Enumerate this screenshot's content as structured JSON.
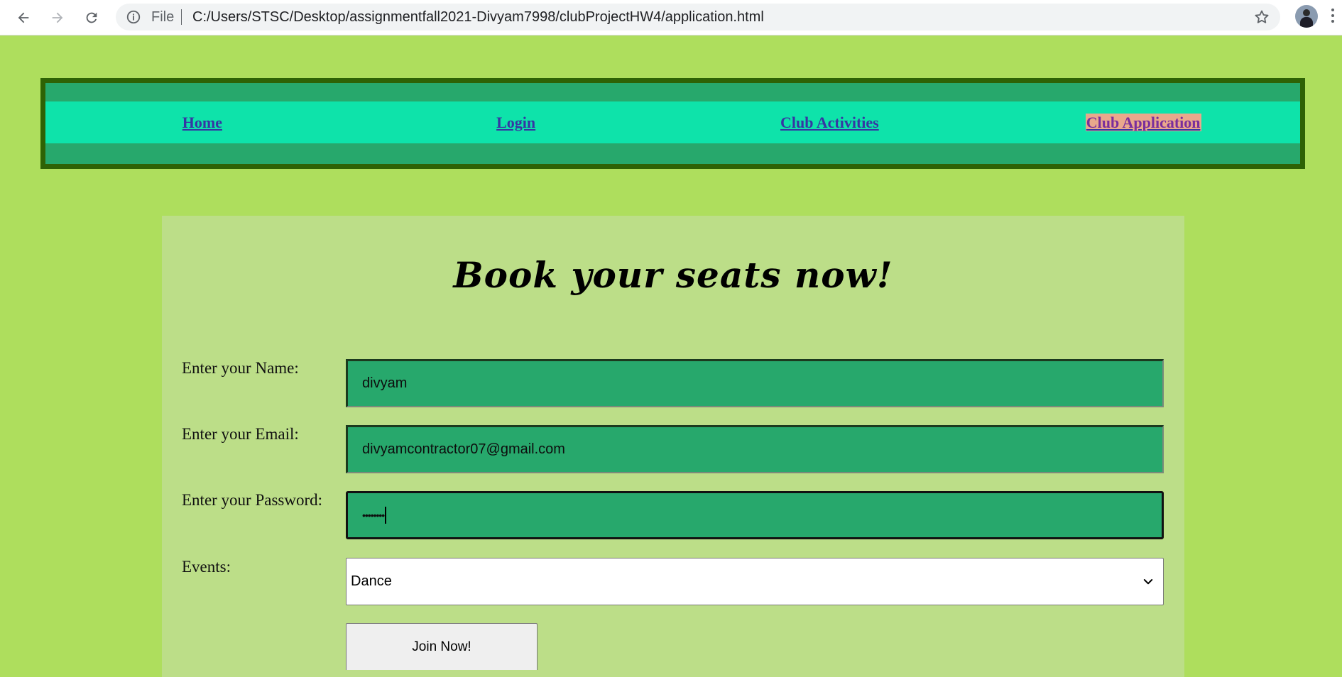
{
  "browser": {
    "scheme_label": "File",
    "url": "C:/Users/STSC/Desktop/assignmentfall2021-Divyam7998/clubProjectHW4/application.html"
  },
  "nav": {
    "items": [
      {
        "label": "Home",
        "active": false
      },
      {
        "label": "Login",
        "active": false
      },
      {
        "label": "Club Activities",
        "active": false
      },
      {
        "label": "Club Application",
        "active": true
      }
    ]
  },
  "form": {
    "title": "Book your seats now!",
    "name_label": "Enter your Name:",
    "name_value": "divyam",
    "email_label": "Enter your Email:",
    "email_value": "divyamcontractor07@gmail.com",
    "password_label": "Enter your Password:",
    "password_masked": "••••••••",
    "events_label": "Events:",
    "events_selected": "Dance",
    "submit_label": "Join Now!"
  },
  "colors": {
    "page_bg": "#aede5d",
    "card_bg": "#bcde88",
    "nav_border": "#2e6205",
    "nav_band": "#27a86c",
    "nav_strip": "#0ee3aa",
    "nav_link": "#3735a3",
    "active_highlight": "#e9a88c",
    "input_bg": "#27a86c"
  }
}
